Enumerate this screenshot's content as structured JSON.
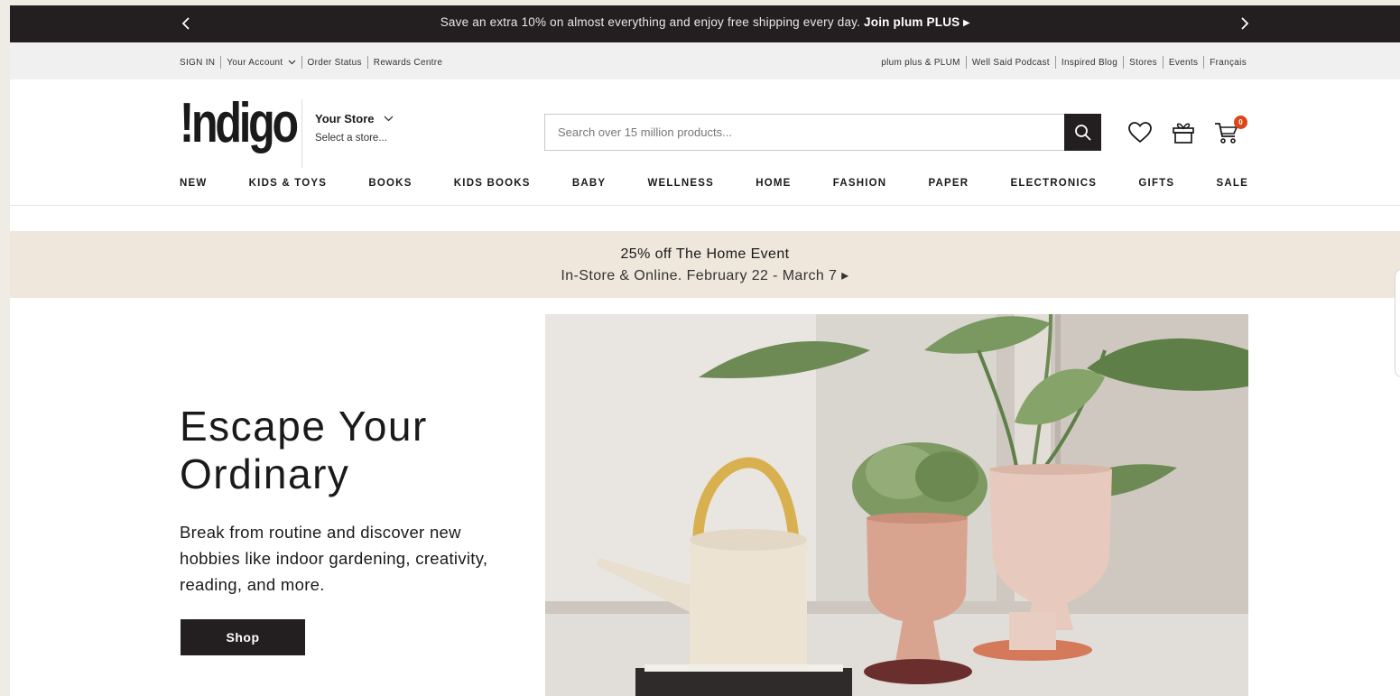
{
  "promo": {
    "message": "Save an extra 10% on almost everything and enjoy free shipping every day.",
    "cta": "Join plum PLUS ▸"
  },
  "utility": {
    "left": [
      "SIGN IN",
      "Your Account",
      "Order Status",
      "Rewards Centre"
    ],
    "right": [
      "plum plus & PLUM",
      "Well Said Podcast",
      "Inspired Blog",
      "Stores",
      "Events",
      "Français"
    ]
  },
  "header": {
    "logo": "!ndigo",
    "store_title": "Your Store",
    "store_subtitle": "Select a store...",
    "search_placeholder": "Search over 15 million products...",
    "cart_count": "0"
  },
  "nav": [
    "NEW",
    "KIDS & TOYS",
    "BOOKS",
    "KIDS BOOKS",
    "BABY",
    "WELLNESS",
    "HOME",
    "FASHION",
    "PAPER",
    "ELECTRONICS",
    "GIFTS",
    "SALE"
  ],
  "event": {
    "title": "25% off The Home Event",
    "subtitle": "In-Store & Online. February 22 - March 7 ▸"
  },
  "hero": {
    "title_line1": "Escape Your",
    "title_line2": "Ordinary",
    "text": "Break from routine and discover new hobbies like indoor gardening, creativity, reading, and more.",
    "button": "Shop"
  },
  "colors": {
    "dark": "#231f20",
    "banner_bg": "#efe6dc",
    "badge": "#d9481b"
  }
}
